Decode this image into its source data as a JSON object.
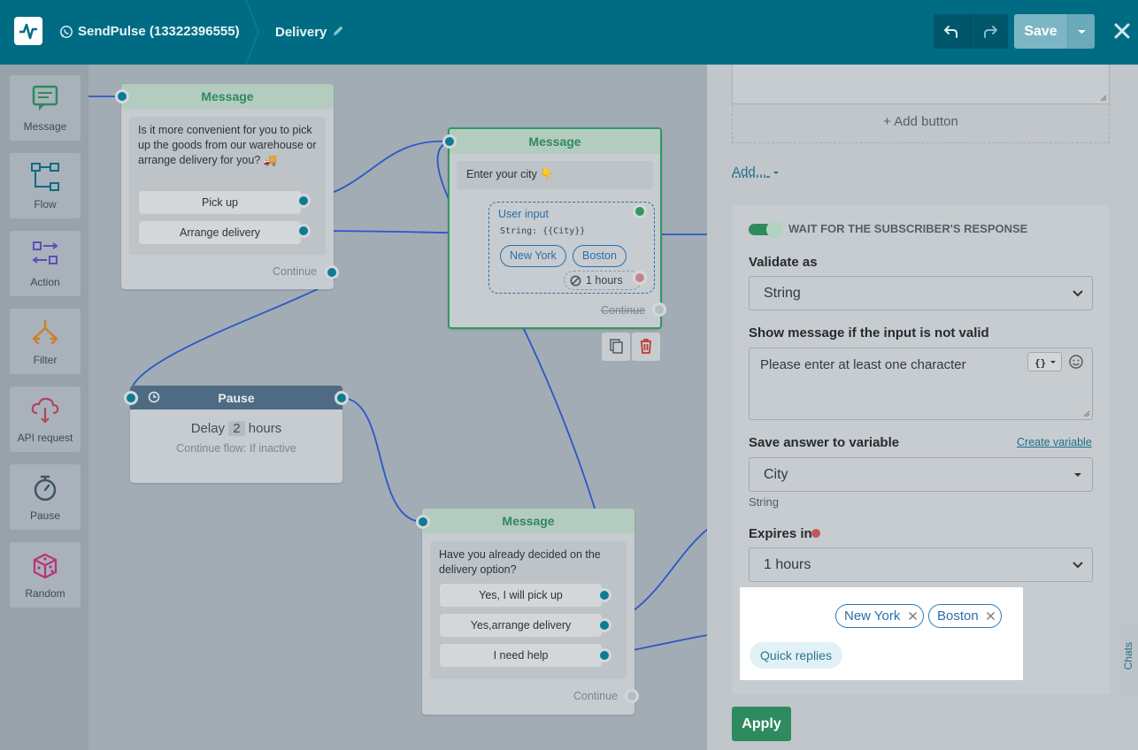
{
  "header": {
    "bot_name": "SendPulse (13322396555)",
    "flow_name": "Delivery",
    "save_label": "Save"
  },
  "toolbar": {
    "items": [
      {
        "label": "Message",
        "icon": "message-icon"
      },
      {
        "label": "Flow",
        "icon": "flow-icon"
      },
      {
        "label": "Action",
        "icon": "action-icon"
      },
      {
        "label": "Filter",
        "icon": "filter-icon"
      },
      {
        "label": "API request",
        "icon": "api-cloud-icon"
      },
      {
        "label": "Pause",
        "icon": "stopwatch-icon"
      },
      {
        "label": "Random",
        "icon": "dice-icon"
      }
    ]
  },
  "canvas": {
    "node1": {
      "title": "Message",
      "text": "Is it more convenient for you to pick up the goods from our warehouse or arrange delivery for you? 🚚",
      "buttons": [
        "Pick up",
        "Arrange delivery"
      ],
      "continue": "Continue"
    },
    "node2": {
      "title": "Message",
      "text": "Enter your city 👇",
      "user_input_title": "User input",
      "user_input_type": "String: {{City}}",
      "chips": [
        "New York",
        "Boston"
      ],
      "expires": "1 hours",
      "continue": "Continue"
    },
    "pause": {
      "title": "Pause",
      "delay_prefix": "Delay",
      "delay_value": "2",
      "delay_unit": "hours",
      "subtitle": "Continue flow: If inactive"
    },
    "node3": {
      "title": "Message",
      "text": "Have you already decided on the delivery option?",
      "buttons": [
        "Yes, I will pick up",
        "Yes,arrange delivery",
        "I need help"
      ],
      "continue": "Continue"
    }
  },
  "panel": {
    "add_button": "+ Add button",
    "add_menu": "Add...",
    "wait_label": "WAIT FOR THE SUBSCRIBER'S RESPONSE",
    "validate_label": "Validate as",
    "validate_value": "String",
    "invalid_msg_label": "Show message if the input is not valid",
    "invalid_msg_value": "Please enter at least one character",
    "save_var_label": "Save answer to variable",
    "create_variable": "Create variable",
    "variable_value": "City",
    "variable_type": "String",
    "expires_label": "Expires in",
    "expires_value": "1 hours",
    "chips": [
      "New York",
      "Boston"
    ],
    "quick_replies": "Quick replies",
    "apply": "Apply",
    "chats_tab": "Chats"
  },
  "colors": {
    "topbar": "#006c84",
    "accent_green": "#2e8a5f",
    "link_blue": "#2a6fab",
    "port_teal": "#0d7c93"
  }
}
